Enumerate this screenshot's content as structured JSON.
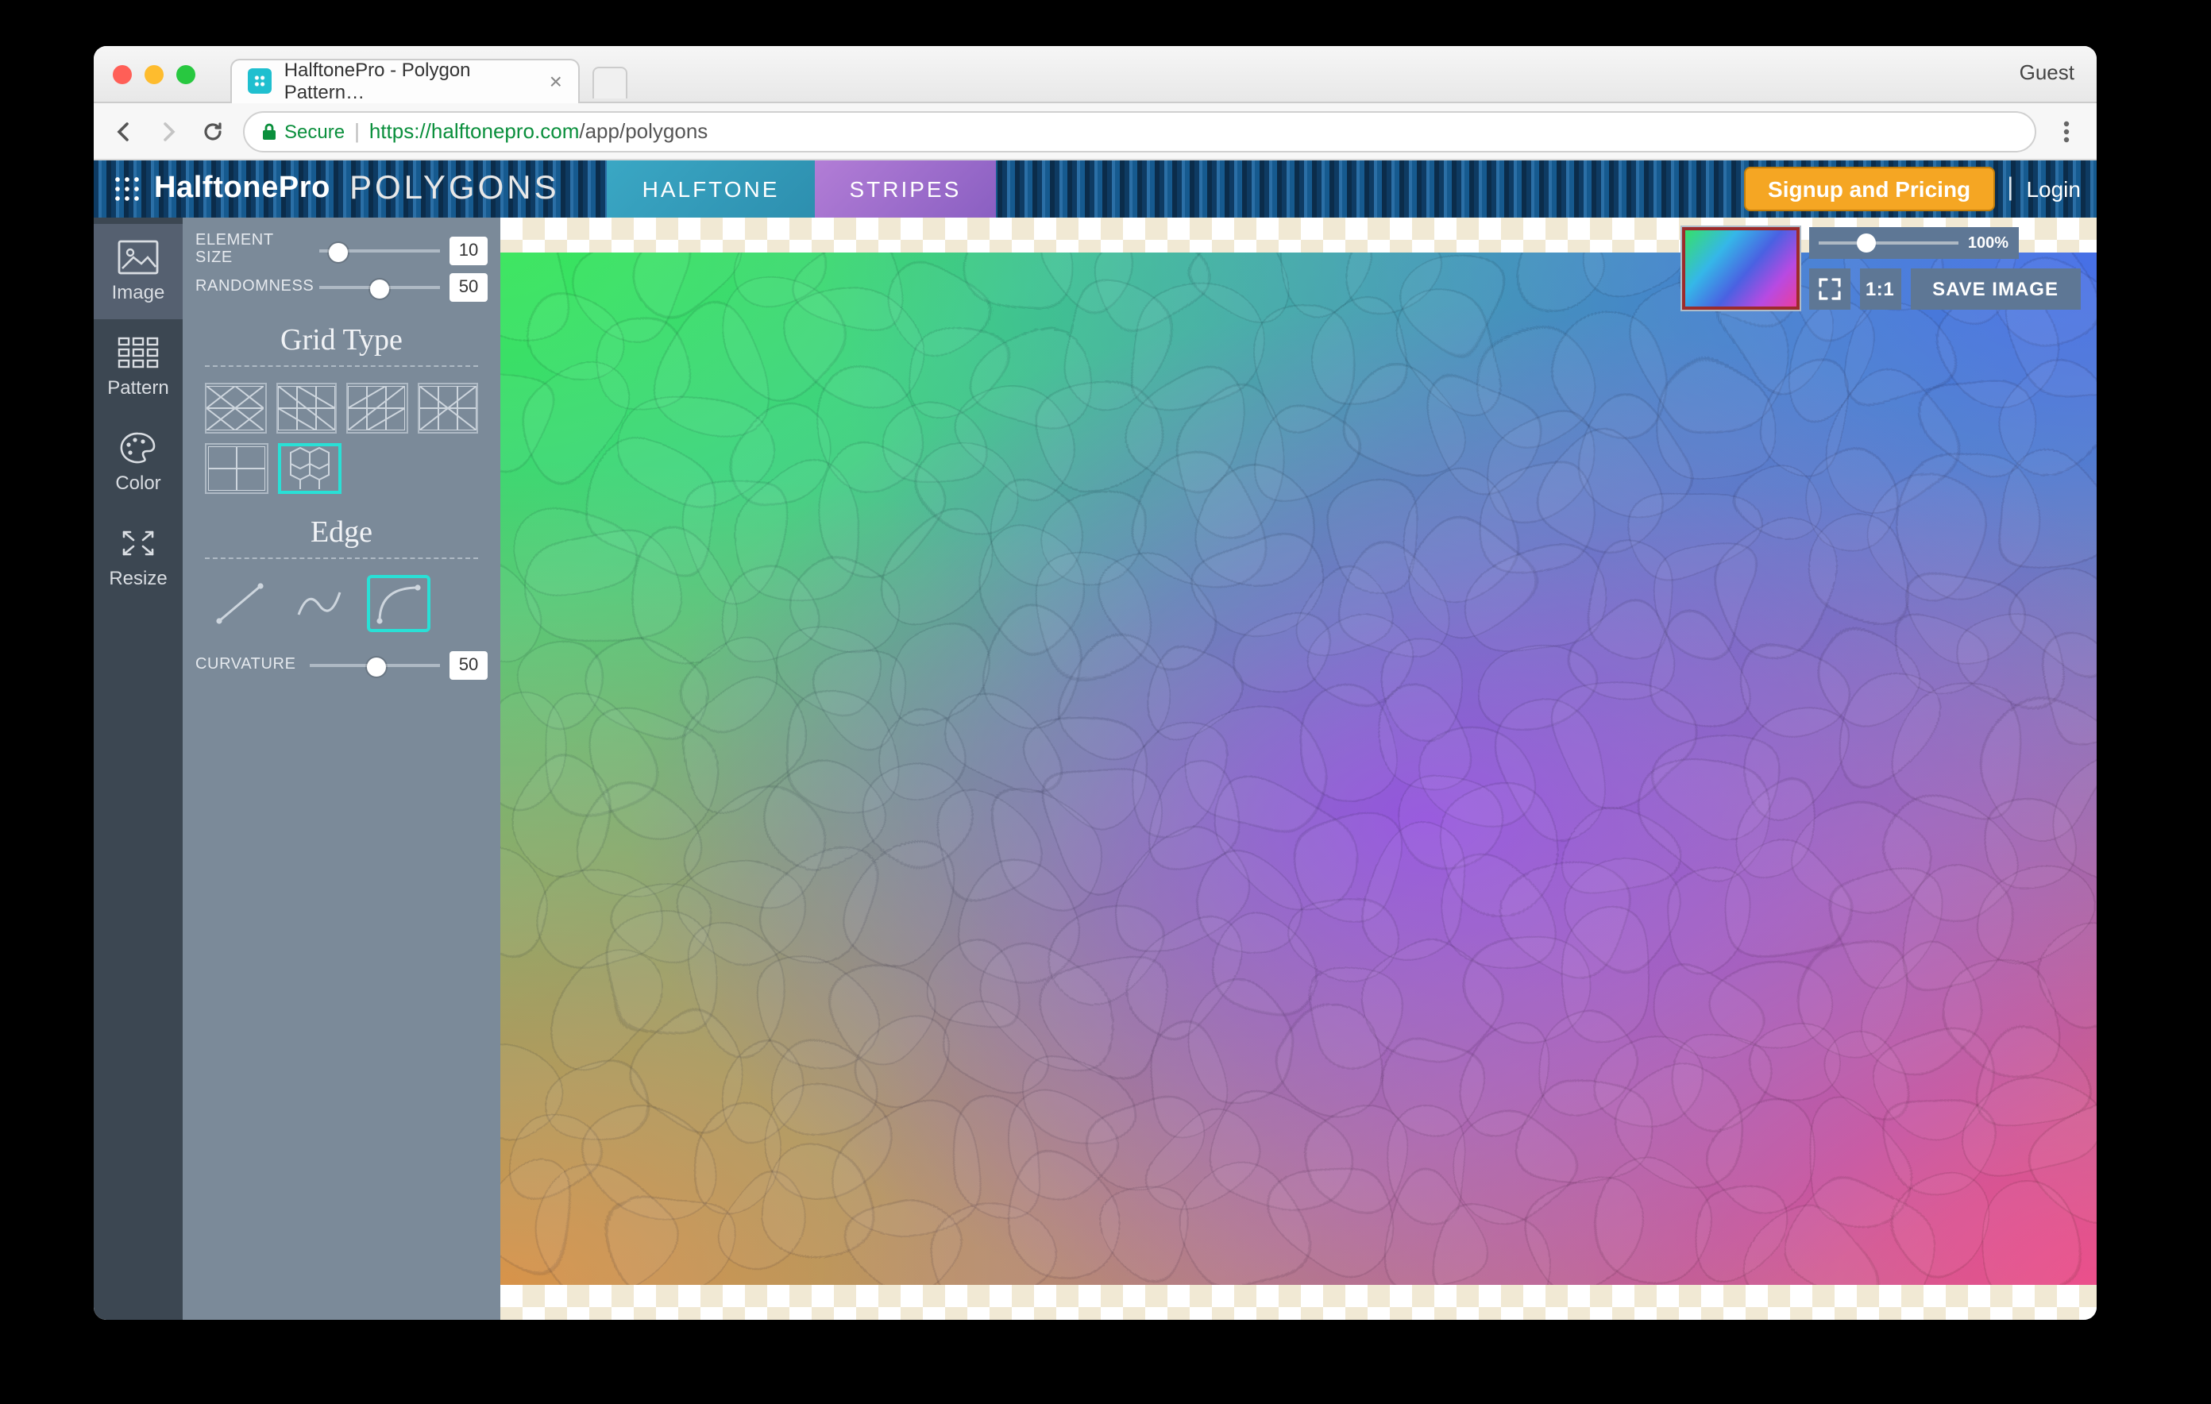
{
  "browser": {
    "tab_title": "HalftonePro - Polygon Pattern…",
    "guest": "Guest",
    "secure_label": "Secure",
    "url_proto": "https://",
    "url_host": "halftonepro.com",
    "url_path": "/app/polygons"
  },
  "header": {
    "brand_main": "HalftonePro",
    "brand_sub": "POLYGONS",
    "mode_halftone": "HALFTONE",
    "mode_stripes": "STRIPES",
    "signup": "Signup and Pricing",
    "login": "Login"
  },
  "rail": {
    "image": "Image",
    "pattern": "Pattern",
    "color": "Color",
    "resize": "Resize"
  },
  "panel": {
    "element_size_label": "ELEMENT SIZE",
    "element_size_value": "10",
    "randomness_label": "RANDOMNESS",
    "randomness_value": "50",
    "grid_type_title": "Grid Type",
    "edge_title": "Edge",
    "curvature_label": "CURVATURE",
    "curvature_value": "50"
  },
  "overlay": {
    "zoom_label": "100%",
    "ratio": "1:1",
    "save": "SAVE IMAGE"
  }
}
